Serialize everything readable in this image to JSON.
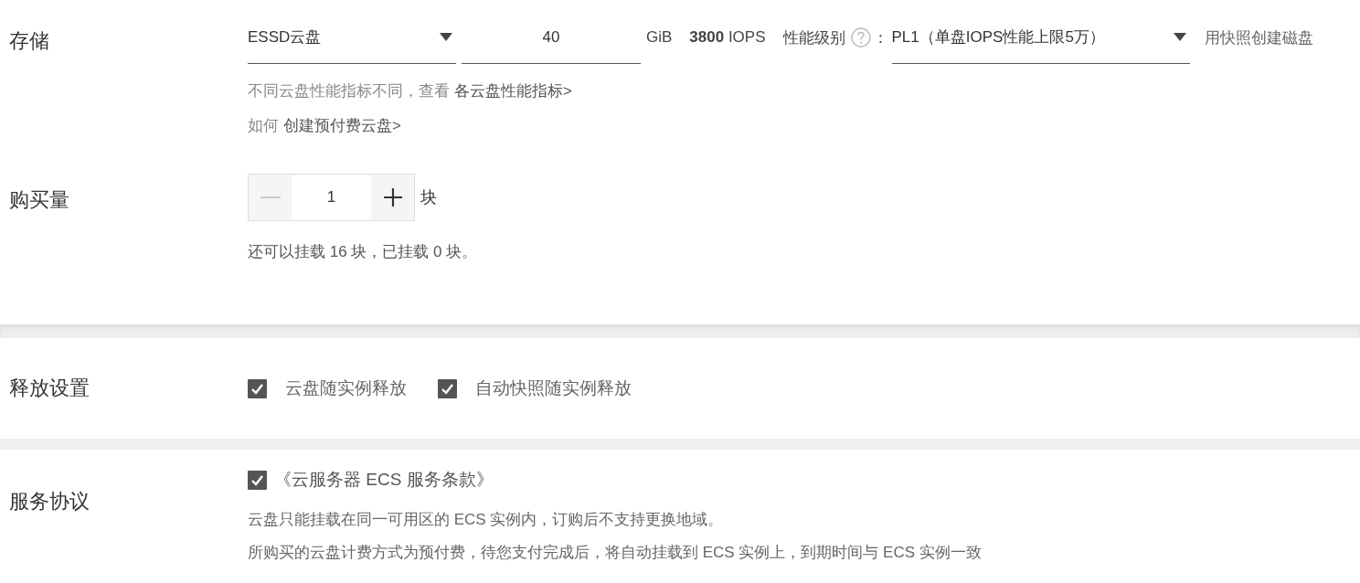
{
  "storage": {
    "label": "存储",
    "disk_type": {
      "value": "ESSD云盘"
    },
    "size": {
      "value": "40"
    },
    "unit": "GiB",
    "iops": "**3800** IOPS",
    "performance_label": "性能级别",
    "colon": "：",
    "performance_level": {
      "value": "PL1（单盘IOPS性能上限5万）"
    },
    "snapshot_link": "用快照创建磁盘",
    "hints": [
      {
        "text": "不同云盘性能指标不同，查看",
        "link": "各云盘性能指标>"
      },
      {
        "text": "如何",
        "link": "创建预付费云盘>"
      }
    ]
  },
  "quantity": {
    "label": "购买量",
    "value": "1",
    "unit": "块",
    "decrement_disabled": true,
    "note": "还可以挂载 16 块，已挂载 0 块。"
  },
  "release": {
    "label": "释放设置",
    "options": [
      {
        "label": "云盘随实例释放",
        "checked": true
      },
      {
        "label": "自动快照随实例释放",
        "checked": true
      }
    ]
  },
  "agreement": {
    "label": "服务协议",
    "checkbox": {
      "label": "《云服务器 ECS 服务条款》",
      "checked": true
    },
    "notes": [
      "云盘只能挂载在同一可用区的 ECS 实例内，订购后不支持更换地域。",
      "所购买的云盘计费方式为预付费，待您支付完成后，将自动挂载到 ECS 实例上，到期时间与 ECS 实例一致"
    ]
  }
}
